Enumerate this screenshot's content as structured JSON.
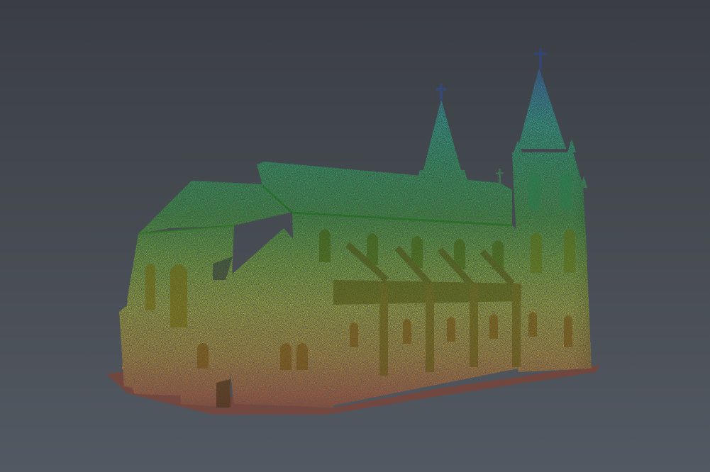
{
  "viewer": {
    "background_top": "#3a3e44",
    "background_bottom": "#525861"
  },
  "point_cloud": {
    "subject": "church",
    "colormap": "height",
    "colormap_stops": [
      "#c83a0e",
      "#e07a12",
      "#d6d21a",
      "#7ed31a",
      "#2db52a",
      "#1fd39a",
      "#2a8fd8",
      "#2b4bb8"
    ],
    "features": [
      "nave",
      "transept-gable",
      "tall-spire-tower",
      "small-spire",
      "buttresses",
      "arched-windows",
      "crosses"
    ]
  }
}
